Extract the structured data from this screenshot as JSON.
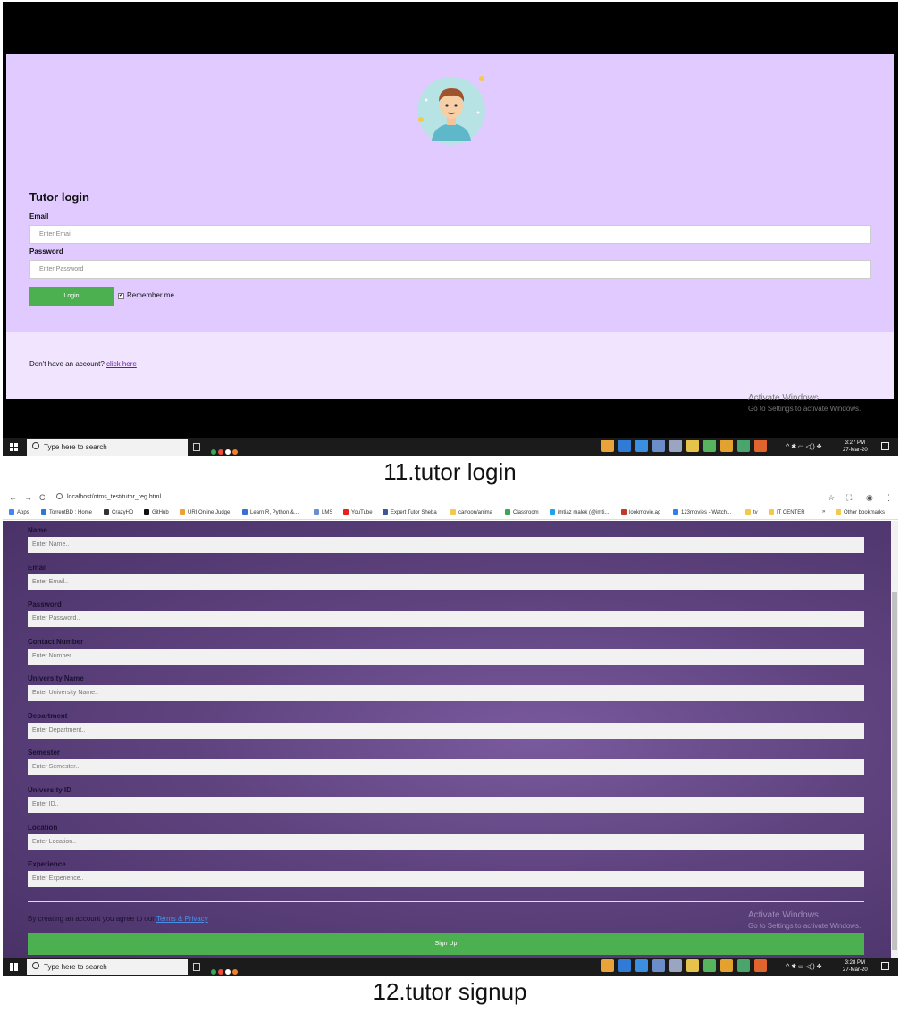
{
  "login": {
    "title": "Tutor login",
    "email_label": "Email",
    "email_placeholder": "Enter Email",
    "password_label": "Password",
    "password_placeholder": "Enter Password",
    "login_button": "Login",
    "remember_label": "Remember me",
    "no_account_text": "Don't have an account?",
    "click_here": "click here",
    "accent": "#4caf50",
    "bg": "#e1caff"
  },
  "windows_watermark": {
    "line1": "Activate Windows",
    "line2": "Go to Settings to activate Windows."
  },
  "taskbar1": {
    "search": "Type here to search",
    "time": "3:27 PM",
    "date": "27-Mar-20"
  },
  "taskbar2": {
    "search": "Type here to search",
    "time": "3:28 PM",
    "date": "27-Mar-20"
  },
  "caption1": "11.tutor login",
  "caption2": "12.tutor signup",
  "browser": {
    "url": "localhost/otms_test/tutor_reg.html",
    "bookmarks": [
      "Apps",
      "TorrentBD : Home",
      "CrazyHD",
      "GitHub",
      "URI Online Judge",
      "Learn R, Python &...",
      "LMS",
      "YouTube",
      "Expert Tutor Sheba",
      "cartoon/anima",
      "Classroom",
      "imtiaz malek (@imti...",
      "lookmovie.ag",
      "123movies - Watch...",
      "tv",
      "IT CENTER",
      "»",
      "Other bookmarks"
    ]
  },
  "signup": {
    "fields": [
      {
        "label": "Name",
        "placeholder": "Enter Name.."
      },
      {
        "label": "Email",
        "placeholder": "Enter Email.."
      },
      {
        "label": "Password",
        "placeholder": "Enter Password.."
      },
      {
        "label": "Contact Number",
        "placeholder": "Enter Number.."
      },
      {
        "label": "University Name",
        "placeholder": "Enter University Name.."
      },
      {
        "label": "Department",
        "placeholder": "Enter Department.."
      },
      {
        "label": "Semester",
        "placeholder": "Enter Semester.."
      },
      {
        "label": "University ID",
        "placeholder": "Enter ID.."
      },
      {
        "label": "Location",
        "placeholder": "Enter Location.."
      },
      {
        "label": "Experience",
        "placeholder": "Enter Experience.."
      }
    ],
    "terms_text": "By creating an account you agree to our",
    "terms_link": "Terms & Privacy",
    "signup_button": "Sign Up"
  }
}
